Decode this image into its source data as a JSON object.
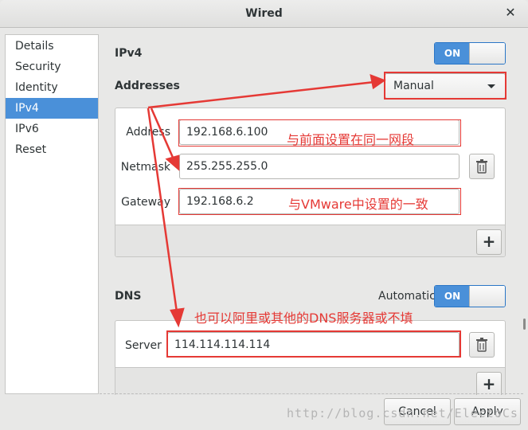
{
  "window": {
    "title": "Wired"
  },
  "sidebar": {
    "items": [
      {
        "label": "Details",
        "active": false
      },
      {
        "label": "Security",
        "active": false
      },
      {
        "label": "Identity",
        "active": false
      },
      {
        "label": "IPv4",
        "active": true
      },
      {
        "label": "IPv6",
        "active": false
      },
      {
        "label": "Reset",
        "active": false
      }
    ]
  },
  "ipv4": {
    "title": "IPv4",
    "toggle_label": "ON",
    "addresses_label": "Addresses",
    "method_value": "Manual",
    "address_label": "Address",
    "address_value": "192.168.6.100",
    "netmask_label": "Netmask",
    "netmask_value": "255.255.255.0",
    "gateway_label": "Gateway",
    "gateway_value": "192.168.6.2",
    "add_label": "+"
  },
  "dns": {
    "title": "DNS",
    "automatic_label": "Automatic",
    "toggle_label": "ON",
    "server_label": "Server",
    "server_value": "114.114.114.114",
    "add_label": "+"
  },
  "annotations": {
    "same_subnet": "与前面设置在同一网段",
    "vmware_match": "与VMware中设置的一致",
    "dns_note": "也可以阿里或其他的DNS服务器或不填"
  },
  "actions": {
    "cancel_label": "Cancel",
    "apply_label": "Apply"
  },
  "watermark": "http://blog.csdn.net/ElectoCs",
  "colors": {
    "accent": "#4a90d9",
    "annotation": "#e53935"
  }
}
